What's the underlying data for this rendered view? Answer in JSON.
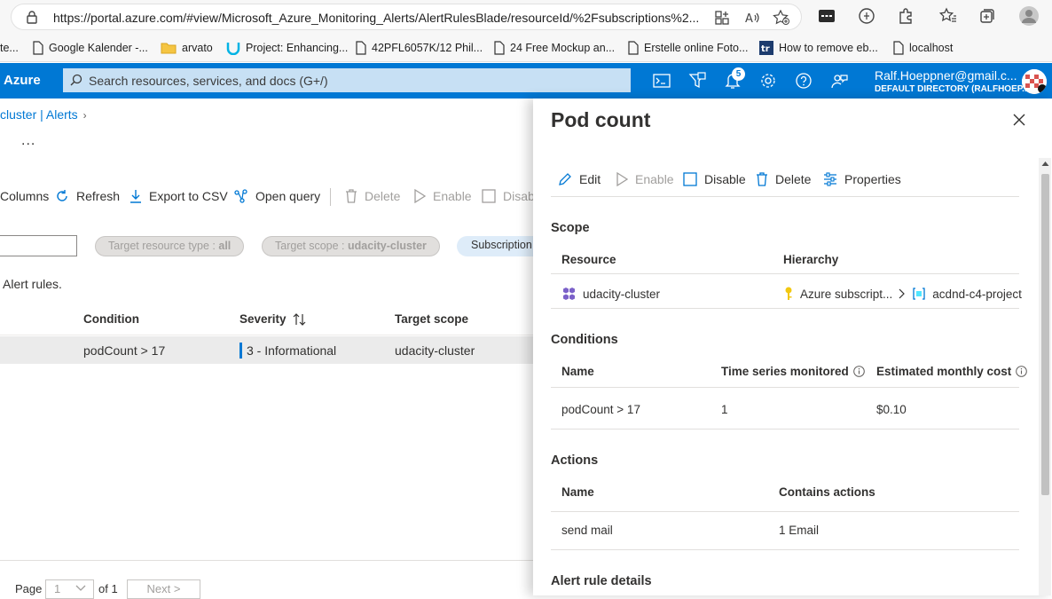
{
  "browser": {
    "url": "https://portal.azure.com/#view/Microsoft_Azure_Monitoring_Alerts/AlertRulesBlade/resourceId/%2Fsubscriptions%2...",
    "bookmarks": [
      "te...",
      "Google Kalender -...",
      "arvato",
      "Project: Enhancing...",
      "42PFL6057K/12 Phil...",
      "24 Free Mockup an...",
      "Erstelle online Foto...",
      "How to remove eb...",
      "localhost"
    ]
  },
  "azure": {
    "brand": "Azure",
    "search_placeholder": "Search resources, services, and docs (G+/)",
    "notification_count": "5",
    "account_email": "Ralf.Hoeppner@gmail.c...",
    "account_directory": "DEFAULT DIRECTORY (RALFHOEP..."
  },
  "blade": {
    "breadcrumb": "cluster | Alerts",
    "ellipsis": "...",
    "toolbar": {
      "columns": "Columns",
      "refresh": "Refresh",
      "export": "Export to CSV",
      "open_query": "Open query",
      "delete": "Delete",
      "enable": "Enable",
      "disable": "Disab"
    },
    "filters": {
      "resource_type_label": "Target resource type : ",
      "resource_type_value": "all",
      "scope_label": "Target scope : ",
      "scope_value": "udacity-cluster",
      "subscription": "Subscription"
    },
    "rules_text": "Alert rules.",
    "columns": {
      "condition": "Condition",
      "severity": "Severity",
      "target_scope": "Target scope"
    },
    "row": {
      "condition": "podCount > 17",
      "severity": "3 - Informational",
      "target_scope": "udacity-cluster"
    },
    "pager": {
      "page_label": "Page",
      "page_value": "1",
      "of_label": "of 1",
      "next": "Next >"
    }
  },
  "panel": {
    "title": "Pod count",
    "commands": {
      "edit": "Edit",
      "enable": "Enable",
      "disable": "Disable",
      "delete": "Delete",
      "properties": "Properties"
    },
    "scope": {
      "heading": "Scope",
      "col_resource": "Resource",
      "col_hierarchy": "Hierarchy",
      "resource": "udacity-cluster",
      "hierarchy_subscription": "Azure subscript...",
      "hierarchy_group": "acdnd-c4-project"
    },
    "conditions": {
      "heading": "Conditions",
      "col_name": "Name",
      "col_series": "Time series monitored",
      "col_cost": "Estimated monthly cost",
      "name": "podCount > 17",
      "series": "1",
      "cost": "$0.10"
    },
    "actions": {
      "heading": "Actions",
      "col_name": "Name",
      "col_contains": "Contains actions",
      "name": "send mail",
      "contains": "1 Email"
    },
    "details_heading": "Alert rule details"
  },
  "colors": {
    "azure_blue": "#0078d4",
    "search_bg": "#c7e0f4",
    "disabled_text": "#a19f9d"
  }
}
